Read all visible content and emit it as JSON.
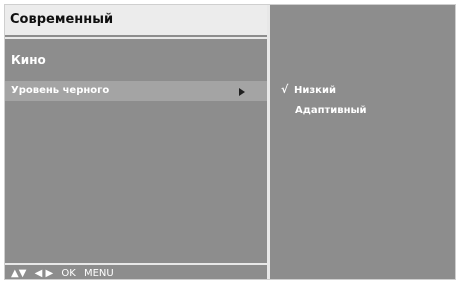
{
  "menu": {
    "title": "Современный",
    "items": [
      {
        "label": "Кино"
      },
      {
        "label": "Уровень черного"
      }
    ]
  },
  "submenu": {
    "options": [
      {
        "label": "Низкий",
        "selected": true
      },
      {
        "label": "Адаптивный",
        "selected": false
      }
    ],
    "check_glyph": "√"
  },
  "footer": {
    "updown": "▲▼",
    "leftright": "◀ ▶",
    "ok": "OK",
    "menu": "MENU"
  },
  "colors": {
    "panel": "#8d8d8d",
    "highlight": "#a4a4a4",
    "title_bg": "#ececec"
  }
}
